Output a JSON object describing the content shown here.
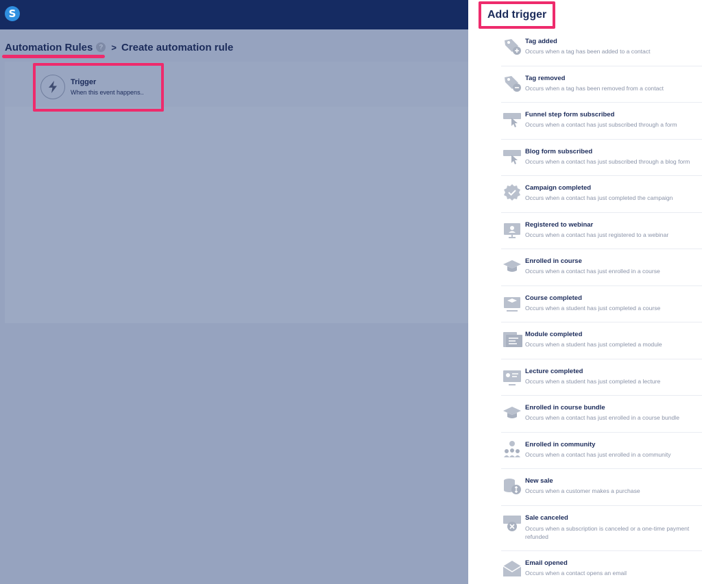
{
  "app": {
    "logo_letter": "S",
    "breadcrumb": {
      "root": "Automation Rules",
      "info_glyph": "?",
      "separator": ">",
      "current": "Create automation rule"
    },
    "trigger_card": {
      "title": "Trigger",
      "subtitle": "When this event happens.."
    }
  },
  "drawer": {
    "title": "Add trigger",
    "items": [
      {
        "name": "Tag added",
        "desc": "Occurs when a tag has been added to a contact",
        "icon": "tag-add-icon"
      },
      {
        "name": "Tag removed",
        "desc": "Occurs when a tag has been removed from a contact",
        "icon": "tag-remove-icon"
      },
      {
        "name": "Funnel step form subscribed",
        "desc": "Occurs when a contact has just subscribed through a form",
        "icon": "form-click-icon"
      },
      {
        "name": "Blog form subscribed",
        "desc": "Occurs when a contact has just subscribed through a blog form",
        "icon": "form-click-icon"
      },
      {
        "name": "Campaign completed",
        "desc": "Occurs when a contact has just completed the campaign",
        "icon": "check-badge-icon"
      },
      {
        "name": "Registered to webinar",
        "desc": "Occurs when a contact has just registered to a webinar",
        "icon": "webinar-icon"
      },
      {
        "name": "Enrolled in course",
        "desc": "Occurs when a contact has just enrolled in a course",
        "icon": "graduation-cap-icon"
      },
      {
        "name": "Course completed",
        "desc": "Occurs when a student has just completed a course",
        "icon": "course-icon"
      },
      {
        "name": "Module completed",
        "desc": "Occurs when a student has just completed a module",
        "icon": "module-icon"
      },
      {
        "name": "Lecture completed",
        "desc": "Occurs when a student has just completed a lecture",
        "icon": "lecture-icon"
      },
      {
        "name": "Enrolled in course bundle",
        "desc": "Occurs when a contact has just enrolled in a course bundle",
        "icon": "graduation-cap-icon"
      },
      {
        "name": "Enrolled in community",
        "desc": "Occurs when a contact has just enrolled in a community",
        "icon": "community-icon"
      },
      {
        "name": "New sale",
        "desc": "Occurs when a customer makes a purchase",
        "icon": "coins-icon"
      },
      {
        "name": "Sale canceled",
        "desc": "Occurs when a subscription is canceled or a one-time payment refunded",
        "icon": "sale-cancel-icon"
      },
      {
        "name": "Email opened",
        "desc": "Occurs when a contact opens an email",
        "icon": "envelope-icon"
      }
    ]
  },
  "colors": {
    "topbar": "#152b62",
    "accent_highlight": "#ee2b6c",
    "text_dark": "#1b2b5a",
    "text_muted": "#8a93a8",
    "icon_gray": "#b9c0cd"
  }
}
